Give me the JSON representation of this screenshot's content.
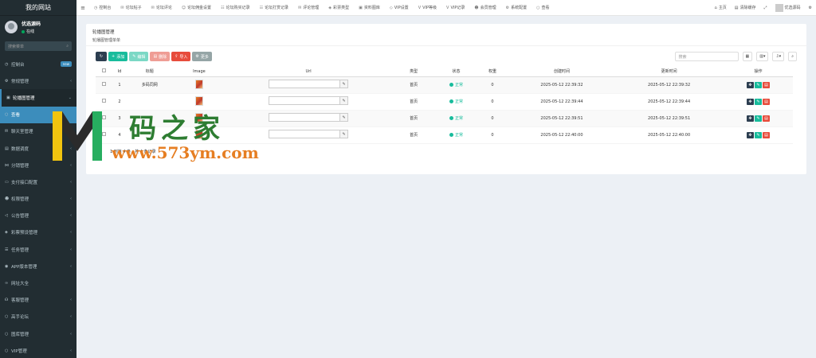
{
  "brand": "我的网站",
  "user": {
    "name": "优选源码",
    "status": "在线"
  },
  "sidebar_search": {
    "placeholder": "搜索菜单"
  },
  "sidebar": [
    {
      "label": "控制台",
      "icon": "dashboard-icon",
      "badge": "new"
    },
    {
      "label": "常规管理",
      "icon": "gears-icon"
    },
    {
      "label": "轮播图管理",
      "icon": "image-icon",
      "open": true
    },
    {
      "label": "查看",
      "icon": "circle-icon",
      "active": true
    },
    {
      "label": "聊天室管理",
      "icon": "comments-icon"
    },
    {
      "label": "数据调度",
      "icon": "file-icon"
    },
    {
      "label": "分销管理",
      "icon": "share-icon"
    },
    {
      "label": "支付接口配置",
      "icon": "credit-card-icon"
    },
    {
      "label": "权限管理",
      "icon": "users-icon"
    },
    {
      "label": "公告管理",
      "icon": "bullhorn-icon"
    },
    {
      "label": "彩票预设管理",
      "icon": "ticket-icon"
    },
    {
      "label": "任务管理",
      "icon": "list-icon"
    },
    {
      "label": "APP版本管理",
      "icon": "android-icon"
    },
    {
      "label": "网址大全",
      "icon": "link-icon"
    },
    {
      "label": "客服管理",
      "icon": "headset-icon"
    },
    {
      "label": "高手论坛",
      "icon": "circle-icon"
    },
    {
      "label": "图库管理",
      "icon": "circle-icon"
    },
    {
      "label": "VIP管理",
      "icon": "circle-icon"
    }
  ],
  "topnav": [
    {
      "label": "控制台"
    },
    {
      "label": "论坛帖子"
    },
    {
      "label": "论坛评论"
    },
    {
      "label": "论坛佣金设置"
    },
    {
      "label": "论坛购买记录"
    },
    {
      "label": "论坛打赏记录"
    },
    {
      "label": "评论管理"
    },
    {
      "label": "彩票类型"
    },
    {
      "label": "资料图库"
    },
    {
      "label": "VIP设置"
    },
    {
      "label": "VIP等级"
    },
    {
      "label": "VIP记录"
    },
    {
      "label": "会员管理"
    },
    {
      "label": "系统配置"
    },
    {
      "label": "查看"
    }
  ],
  "topright": {
    "home": "主页",
    "clear_cache": "清除缓存",
    "username": "优选源码"
  },
  "panel": {
    "title": "轮播图管理",
    "subtitle": "轮播图管理单单"
  },
  "toolbar": {
    "add": "添加",
    "edit": "编辑",
    "delete": "删除",
    "import": "导入",
    "more": "更多",
    "search_placeholder": "搜索"
  },
  "table": {
    "headers": [
      "Id",
      "标题",
      "Image",
      "Url",
      "类型",
      "状态",
      "权重",
      "创建时间",
      "更新时间",
      "操作"
    ],
    "rows": [
      {
        "id": "1",
        "title": "多码同网",
        "type": "首页",
        "status": "正常",
        "weight": "0",
        "created": "2025-05-12 22:39:32",
        "updated": "2025-05-12 22:39:32"
      },
      {
        "id": "2",
        "title": "",
        "type": "首页",
        "status": "正常",
        "weight": "0",
        "created": "2025-05-12 22:39:44",
        "updated": "2025-05-12 22:39:44"
      },
      {
        "id": "3",
        "title": "",
        "type": "首页",
        "status": "正常",
        "weight": "0",
        "created": "2025-05-12 22:39:51",
        "updated": "2025-05-12 22:39:51"
      },
      {
        "id": "4",
        "title": "",
        "type": "首页",
        "status": "正常",
        "weight": "0",
        "created": "2025-05-12 22:40:00",
        "updated": "2025-05-12 22:40:00"
      }
    ]
  },
  "pager": "1 到第 4 条，共 4 条记录",
  "watermark": {
    "cn": "码之家",
    "url": "www.573ym.com"
  },
  "colors": {
    "sidebar": "#222d32",
    "active": "#3c8dbc",
    "success": "#18bc9c",
    "danger": "#e74c3c",
    "dark": "#2c3e50"
  }
}
